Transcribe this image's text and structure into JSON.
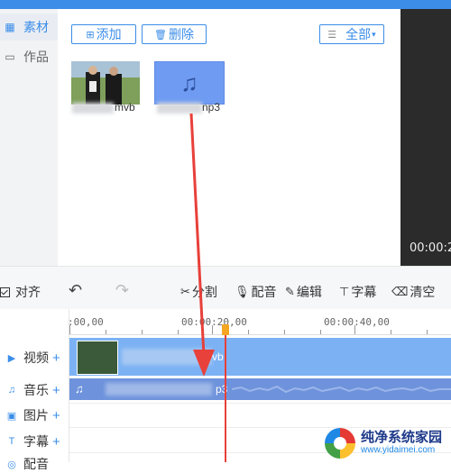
{
  "nav": {
    "items": [
      {
        "label": "素材",
        "icon": "grid-icon",
        "active": true
      },
      {
        "label": "作品",
        "icon": "folder-icon",
        "active": false
      }
    ]
  },
  "media": {
    "add_label": "添加",
    "delete_label": "删除",
    "filter_label": "全部",
    "files": [
      {
        "name_suffix": "mvb",
        "type": "video"
      },
      {
        "name_suffix": "np3",
        "type": "audio"
      }
    ]
  },
  "preview": {
    "timecode": "00:00:2"
  },
  "toolbar": {
    "align_label": "对齐",
    "split_label": "分割",
    "dub_label": "配音",
    "edit_label": "编辑",
    "subtitle_label": "字幕",
    "clear_label": "清空"
  },
  "timeline": {
    "ruler_labels": [
      ":00,00",
      "00:00:20,00",
      "00:00:40,00"
    ],
    "tracks": [
      {
        "label": "视频",
        "icon": "video-icon"
      },
      {
        "label": "音乐",
        "icon": "music-icon"
      },
      {
        "label": "图片",
        "icon": "image-icon"
      },
      {
        "label": "字幕",
        "icon": "text-icon"
      },
      {
        "label": "配音",
        "icon": "mic-icon"
      }
    ],
    "video_clip_name": "vb",
    "audio_clip_name": "p3",
    "plus": "+"
  },
  "watermark": {
    "title": "纯净系统家园",
    "url": "www.yidaimei.com"
  },
  "colors": {
    "accent": "#3b8de8",
    "annotation": "#e8403a"
  }
}
